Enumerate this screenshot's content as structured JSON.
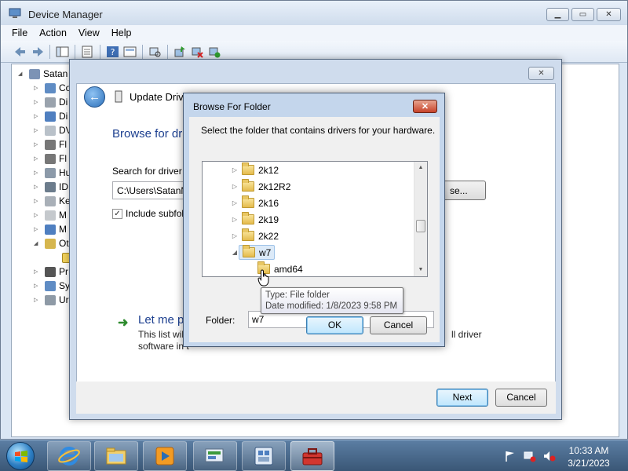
{
  "device_manager": {
    "title": "Device Manager",
    "menu": [
      "File",
      "Action",
      "View",
      "Help"
    ],
    "tree_root": "Satan",
    "tree_items": [
      "Co",
      "Di",
      "Di",
      "DV",
      "Fl",
      "Fl",
      "Hu",
      "ID",
      "Ke",
      "M",
      "M",
      "Ot",
      "",
      "Pr",
      "Sy",
      "Ur"
    ]
  },
  "wizard": {
    "title": "Update Driver S",
    "heading": "Browse for dri",
    "search_label": "Search for driver so",
    "path_value": "C:\\Users\\SatanNa",
    "browse_label": "se...",
    "include_subfolders_label": "Include subfold",
    "include_subfolders_checked": true,
    "let_me_label": "Let me pi",
    "let_me_desc_line1": "This list will s",
    "let_me_desc_tail": "ll driver",
    "let_me_desc_line2": "software in t",
    "next_label": "Next",
    "cancel_label": "Cancel"
  },
  "browse_dialog": {
    "title": "Browse For Folder",
    "close_glyph": "✕",
    "instruction": "Select the folder that contains drivers for your hardware.",
    "folders": [
      {
        "name": "2k12",
        "expanded": false
      },
      {
        "name": "2k12R2",
        "expanded": false
      },
      {
        "name": "2k16",
        "expanded": false
      },
      {
        "name": "2k19",
        "expanded": false
      },
      {
        "name": "2k22",
        "expanded": false
      },
      {
        "name": "w7",
        "expanded": true,
        "selected": true
      },
      {
        "name": "amd64",
        "child": true
      }
    ],
    "folder_label": "Folder:",
    "folder_value": "w7",
    "ok_label": "OK",
    "cancel_label": "Cancel"
  },
  "tooltip": {
    "line1": "Type: File folder",
    "line2": "Date modified: 1/8/2023 9:58 PM"
  },
  "taskbar": {
    "apps": [
      "internet-explorer-icon",
      "file-explorer-icon",
      "media-player-icon",
      "control-panel-icon",
      "device-manager-icon",
      "toolbox-icon"
    ],
    "time": "10:33 AM",
    "date": "3/21/2023"
  },
  "colors": {
    "heading_blue": "#1c3f8f",
    "taskbar": "#3a5776",
    "close_red": "#c7432a"
  }
}
